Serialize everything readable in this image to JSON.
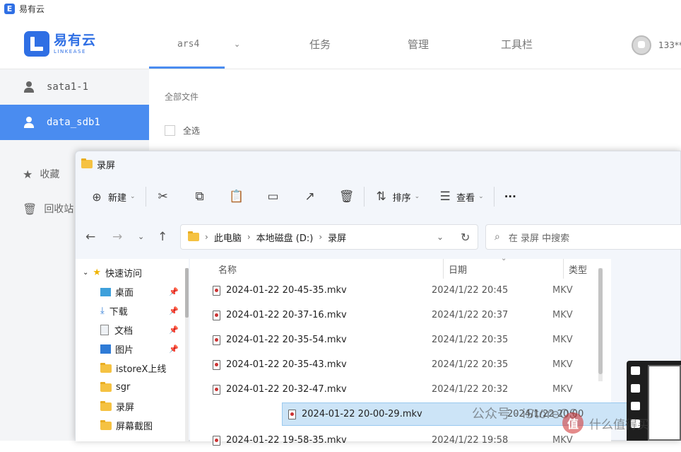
{
  "app": {
    "window_title": "易有云",
    "brand_name": "易有云",
    "brand_sub": "LINKEASE",
    "nav": [
      "ars4",
      "任务",
      "管理",
      "工具栏"
    ],
    "user": "133**",
    "sidebar": [
      {
        "label": "sata1-1",
        "icon": "person-icon"
      },
      {
        "label": "data_sdb1",
        "icon": "person-icon",
        "active": true
      },
      {
        "label": "收藏",
        "icon": "star-icon"
      },
      {
        "label": "回收站",
        "icon": "trash-icon"
      }
    ],
    "breadcrumb": "全部文件",
    "select_all": "全选",
    "accent": "#4a8cf0"
  },
  "explorer": {
    "title": "录屏",
    "toolbar": {
      "new": "新建",
      "sort": "排序",
      "view": "查看",
      "more": "···"
    },
    "address": [
      "此电脑",
      "本地磁盘 (D:)",
      "录屏"
    ],
    "search_placeholder": "在 录屏 中搜索",
    "nav_pane": [
      {
        "label": "快速访问",
        "icon": "star-icon",
        "expanded": true
      },
      {
        "label": "桌面",
        "icon": "desktop-icon",
        "pinned": true
      },
      {
        "label": "下载",
        "icon": "download-icon",
        "pinned": true
      },
      {
        "label": "文档",
        "icon": "document-icon",
        "pinned": true
      },
      {
        "label": "图片",
        "icon": "picture-icon",
        "pinned": true
      },
      {
        "label": "istoreX上线",
        "icon": "folder-icon"
      },
      {
        "label": "sgr",
        "icon": "folder-icon"
      },
      {
        "label": "录屏",
        "icon": "folder-icon"
      },
      {
        "label": "屏幕截图",
        "icon": "folder-icon"
      }
    ],
    "columns": {
      "name": "名称",
      "date": "日期",
      "type": "类型"
    },
    "files": [
      {
        "name": "2024-01-22 20-45-35.mkv",
        "date": "2024/1/22 20:45",
        "type": "MKV"
      },
      {
        "name": "2024-01-22 20-37-16.mkv",
        "date": "2024/1/22 20:37",
        "type": "MKV"
      },
      {
        "name": "2024-01-22 20-35-54.mkv",
        "date": "2024/1/22 20:35",
        "type": "MKV"
      },
      {
        "name": "2024-01-22 20-35-43.mkv",
        "date": "2024/1/22 20:35",
        "type": "MKV"
      },
      {
        "name": "2024-01-22 20-32-47.mkv",
        "date": "2024/1/22 20:32",
        "type": "MKV"
      },
      {
        "name": "2024-01-22 20-00-29.mkv",
        "date": "2024/1/22 20:00",
        "type": "MKV",
        "selected": true
      },
      {
        "name": "2024-01-22 19-58-35.mkv",
        "date": "2024/1/22 19:58",
        "type": "MKV"
      }
    ]
  },
  "watermark": {
    "wechat": "公众号 · iStoreOS",
    "site": "什么值得买",
    "badge": "值"
  }
}
